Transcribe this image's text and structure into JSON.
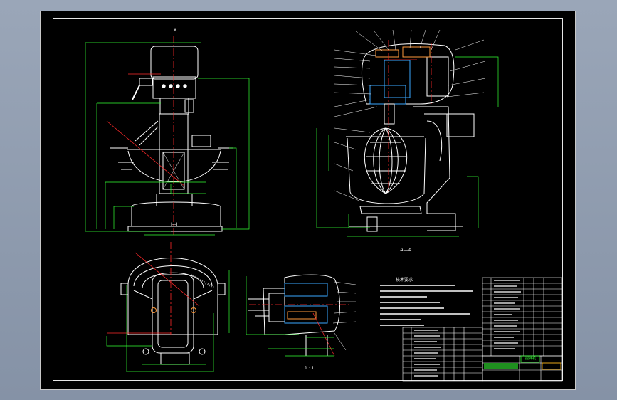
{
  "drawing": {
    "view_label_front": "I—I",
    "view_label_section": "A—A",
    "scale_label": "1 : 1",
    "view_label_side": "A",
    "tech_requirements_title": "技术要求",
    "tech_requirements": [
      "1.",
      "2.",
      "3.",
      "4.",
      "5.",
      "6.",
      "7.",
      "8."
    ],
    "title_block_name": "搅拌机",
    "colors": {
      "background": "#000000",
      "outline": "#ffffff",
      "dimension": "#33ff33",
      "centerline": "#ff2a2a",
      "hatch": "#3aa7ff",
      "accent": "#ff9a3c"
    }
  }
}
